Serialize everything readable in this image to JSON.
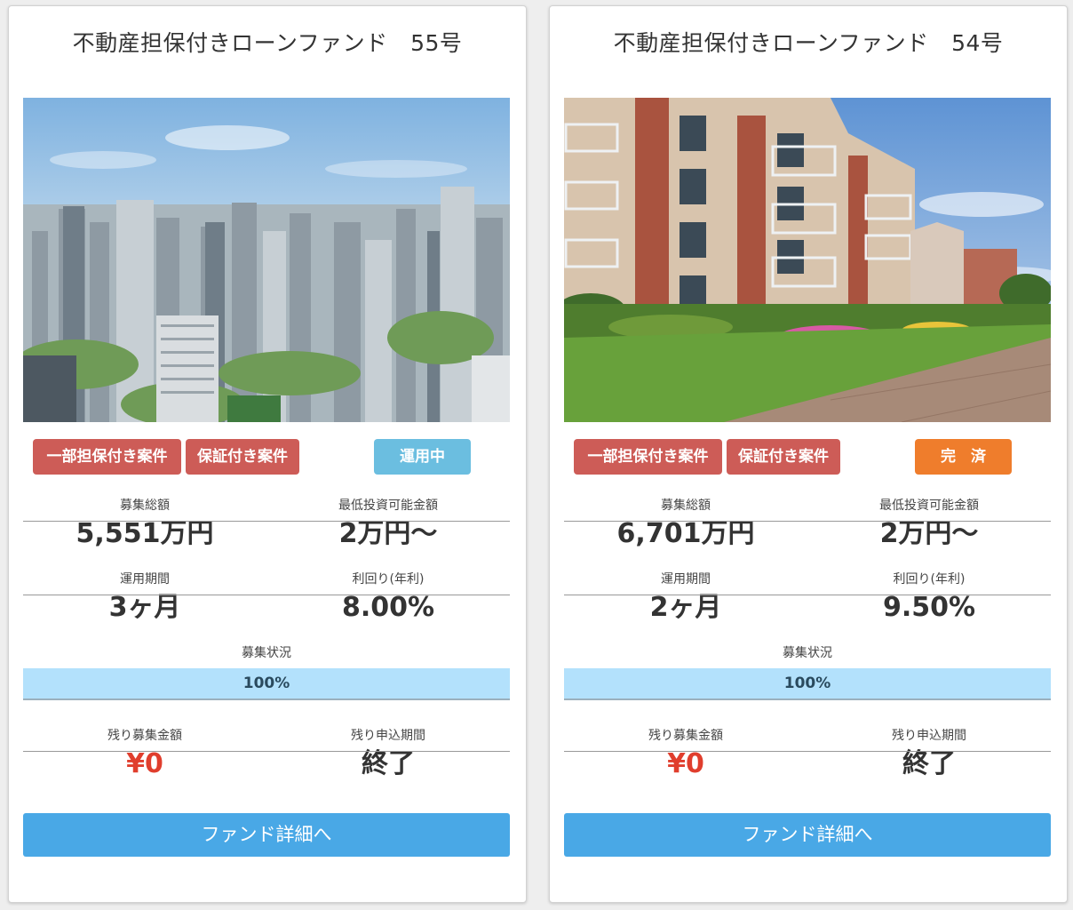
{
  "funds": [
    {
      "title": "不動産担保付きローンファンド　55号",
      "tags": [
        "一部担保付き案件",
        "保証付き案件"
      ],
      "status_label": "運用中",
      "status_color": "#6bbee0",
      "total_label": "募集総額",
      "total_value": "5,551万円",
      "min_label": "最低投資可能金額",
      "min_value": "2万円〜",
      "period_label": "運用期間",
      "period_value": "3ヶ月",
      "yield_label": "利回り(年利)",
      "yield_value": "8.00%",
      "status_section_label": "募集状況",
      "progress_text": "100%",
      "progress": 1.0,
      "remaining_amount_label": "残り募集金額",
      "remaining_amount_value": "¥0",
      "remaining_period_label": "残り申込期間",
      "remaining_period_value": "終了",
      "button_label": "ファンド詳細へ",
      "photo": "tokyo-city-skyline"
    },
    {
      "title": "不動産担保付きローンファンド　54号",
      "tags": [
        "一部担保付き案件",
        "保証付き案件"
      ],
      "status_label": "完　済",
      "status_color": "#ef7d2c",
      "total_label": "募集総額",
      "total_value": "6,701万円",
      "min_label": "最低投資可能金額",
      "min_value": "2万円〜",
      "period_label": "運用期間",
      "period_value": "2ヶ月",
      "yield_label": "利回り(年利)",
      "yield_value": "9.50%",
      "status_section_label": "募集状況",
      "progress_text": "100%",
      "progress": 1.0,
      "remaining_amount_label": "残り募集金額",
      "remaining_amount_value": "¥0",
      "remaining_period_label": "残り申込期間",
      "remaining_period_value": "終了",
      "button_label": "ファンド詳細へ",
      "photo": "apartment-building-garden"
    }
  ]
}
